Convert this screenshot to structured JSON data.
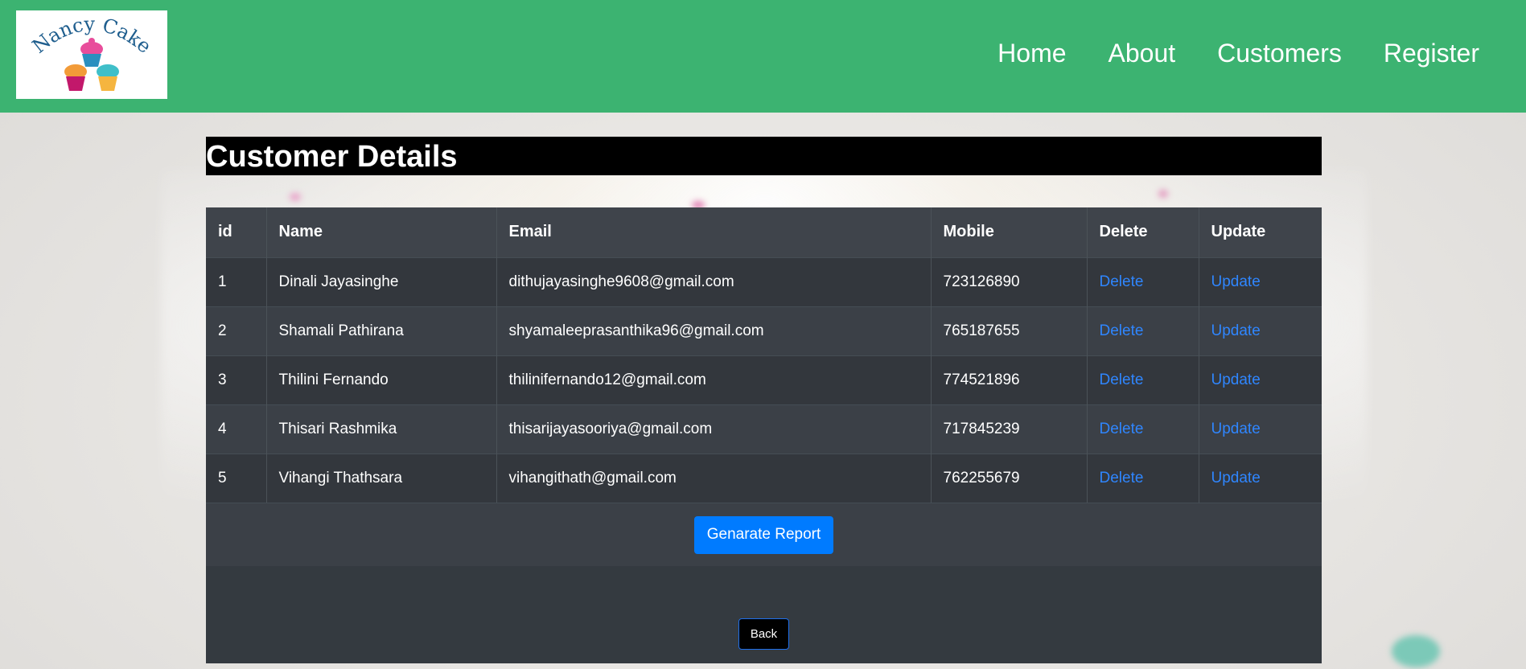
{
  "header": {
    "logo_text": "Nancy Cake",
    "nav": [
      "Home",
      "About",
      "Customers",
      "Register"
    ]
  },
  "page_title": "Customer Details",
  "table": {
    "columns": [
      "id",
      "Name",
      "Email",
      "Mobile",
      "Delete",
      "Update"
    ],
    "rows": [
      {
        "id": "1",
        "name": "Dinali Jayasinghe",
        "email": "dithujayasinghe9608@gmail.com",
        "mobile": "723126890",
        "delete": "Delete",
        "update": "Update"
      },
      {
        "id": "2",
        "name": "Shamali Pathirana",
        "email": "shyamaleeprasanthika96@gmail.com",
        "mobile": "765187655",
        "delete": "Delete",
        "update": "Update"
      },
      {
        "id": "3",
        "name": "Thilini Fernando",
        "email": "thilinifernando12@gmail.com",
        "mobile": "774521896",
        "delete": "Delete",
        "update": "Update"
      },
      {
        "id": "4",
        "name": "Thisari Rashmika",
        "email": "thisarijayasooriya@gmail.com",
        "mobile": "717845239",
        "delete": "Delete",
        "update": "Update"
      },
      {
        "id": "5",
        "name": "Vihangi Thathsara",
        "email": "vihangithath@gmail.com",
        "mobile": "762255679",
        "delete": "Delete",
        "update": "Update"
      }
    ]
  },
  "report_button": "Genarate Report",
  "back_button": "Back",
  "colors": {
    "header_bg": "#3cb371",
    "table_bg": "#343a40",
    "link": "#2f86ff",
    "primary_button": "#007bff"
  }
}
